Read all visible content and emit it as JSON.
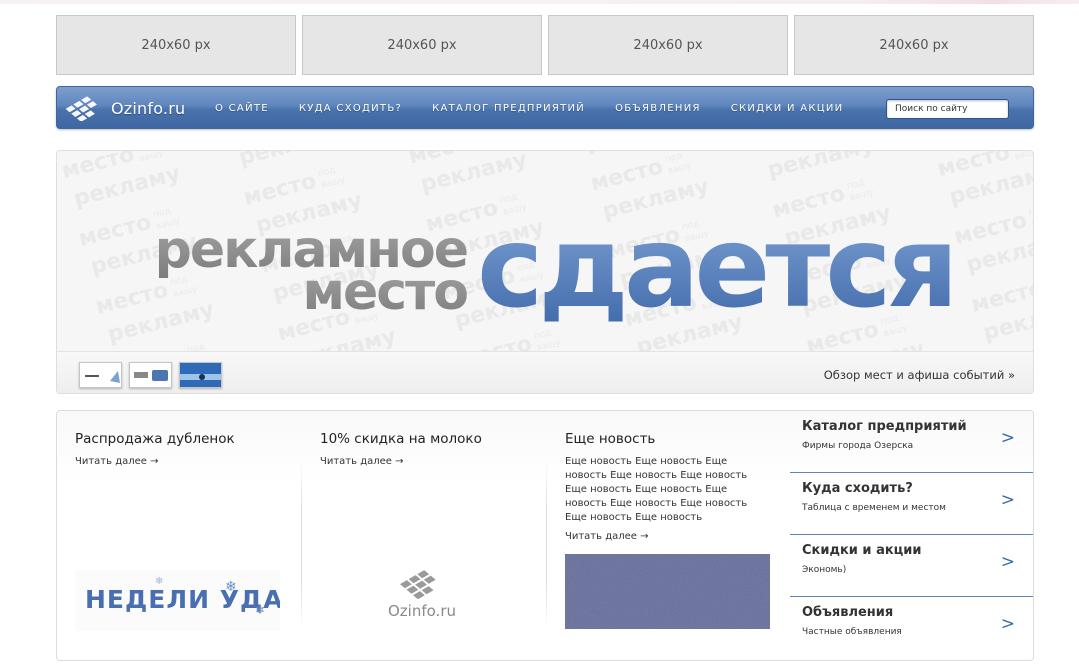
{
  "ad_slots": [
    "240x60 px",
    "240x60 px",
    "240x60 px",
    "240x60 px"
  ],
  "nav": {
    "logo_text": "Ozinfo.ru",
    "links": [
      "О САЙТЕ",
      "КУДА СХОДИТЬ?",
      "КАТАЛОГ ПРЕДПРИЯТИЙ",
      "ОБЪЯВЛЕНИЯ",
      "СКИДКИ И АКЦИИ"
    ],
    "search_placeholder": "Поиск по сайту"
  },
  "banner": {
    "background_text": "место под вашу рекламу",
    "headline_line1": "рекламное",
    "headline_line2": "место",
    "headline_big": "сдается",
    "link_text": "Обзор мест и афиша событий »"
  },
  "news": [
    {
      "title": "Распродажа дубленок",
      "body": "",
      "read_more": "Читать далее →",
      "image_caption": "НЕДЕЛИ УДАЧНЫХ"
    },
    {
      "title": "10% скидка на молоко",
      "body": "",
      "read_more": "Читать далее →",
      "image_caption": "Ozinfo.ru"
    },
    {
      "title": "Еще новость",
      "body": "Еще новость Еще новость Еще новость Еще новость Еще новость Еще новость Еще новость Еще новость Еще новость Еще новость Еще новость Еще новость",
      "read_more": "Читать далее →",
      "image_caption": ""
    }
  ],
  "sidebar": [
    {
      "title": "Каталог предприятий",
      "subtitle": "Фирмы города Озерска",
      "arrow": ">"
    },
    {
      "title": "Куда сходить?",
      "subtitle": "Таблица с временем и местом",
      "arrow": ">"
    },
    {
      "title": "Скидки и акции",
      "subtitle": "Экономь)",
      "arrow": ">"
    },
    {
      "title": "Объявления",
      "subtitle": "Частные объявления",
      "arrow": ">"
    }
  ],
  "colors": {
    "nav_blue": "#4a73ad",
    "accent_blue": "#5a86bd",
    "ad_slot_gray": "#e6e6e6"
  }
}
